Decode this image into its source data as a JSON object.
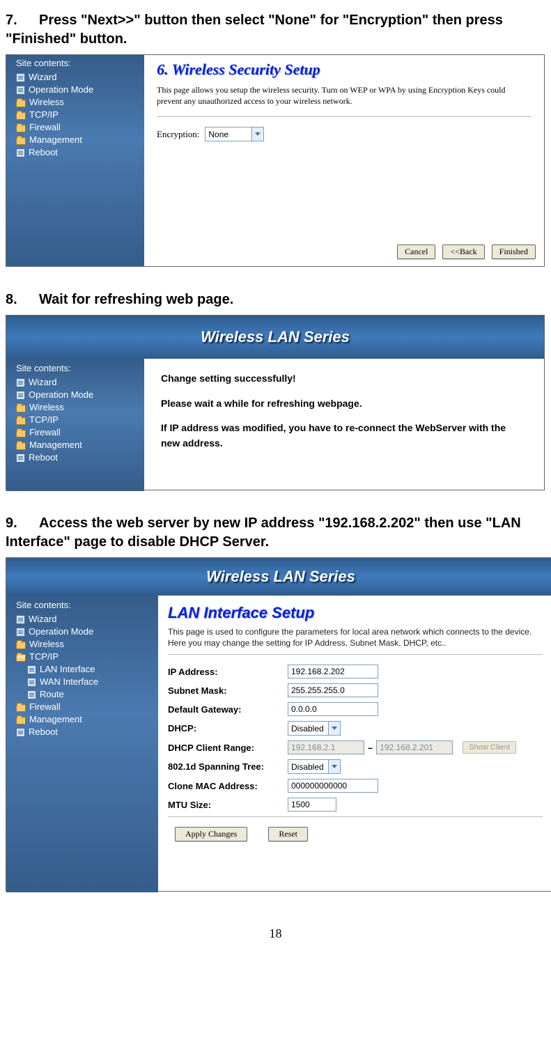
{
  "steps": {
    "s7": "Press \"Next>>\" button then select \"None\" for \"Encryption\" then press \"Finished\" button.",
    "s8": "Wait for refreshing web page.",
    "s9": "Access the web server by new IP address \"192.168.2.202\" then use \"LAN Interface\" page to disable DHCP Server."
  },
  "sidebar": {
    "title": "Site contents:",
    "items": [
      "Wizard",
      "Operation Mode",
      "Wireless",
      "TCP/IP",
      "Firewall",
      "Management",
      "Reboot"
    ],
    "tcp_children": [
      "LAN Interface",
      "WAN Interface",
      "Route"
    ]
  },
  "panel1": {
    "title": "6. Wireless Security Setup",
    "desc": "This page allows you setup the wireless security. Turn on WEP or WPA by using Encryption Keys could prevent any unauthorized access to your wireless network.",
    "enc_label": "Encryption:",
    "enc_value": "None",
    "buttons": {
      "cancel": "Cancel",
      "back": "<<Back",
      "finished": "Finished"
    }
  },
  "banner": "Wireless LAN Series",
  "panel2": {
    "line1": "Change setting successfully!",
    "line2": "Please wait a while for refreshing webpage.",
    "line3": "If IP address was modified, you have to re-connect the WebServer with the new address."
  },
  "panel3": {
    "title": "LAN Interface Setup",
    "desc": "This page is used to configure the parameters for local area network which connects to the device. Here you may change the setting for IP Address, Subnet Mask, DHCP, etc..",
    "fields": {
      "ip_label": "IP Address:",
      "ip_value": "192.168.2.202",
      "mask_label": "Subnet Mask:",
      "mask_value": "255.255.255.0",
      "gw_label": "Default Gateway:",
      "gw_value": "0.0.0.0",
      "dhcp_label": "DHCP:",
      "dhcp_value": "Disabled",
      "range_label": "DHCP Client Range:",
      "range_from": "192.168.2.1",
      "range_to": "192.168.2.201",
      "stp_label": "802.1d Spanning Tree:",
      "stp_value": "Disabled",
      "mac_label": "Clone MAC Address:",
      "mac_value": "000000000000",
      "mtu_label": "MTU Size:",
      "mtu_value": "1500"
    },
    "buttons": {
      "apply": "Apply Changes",
      "reset": "Reset",
      "showclient": "Show Client"
    }
  },
  "page_number": "18"
}
